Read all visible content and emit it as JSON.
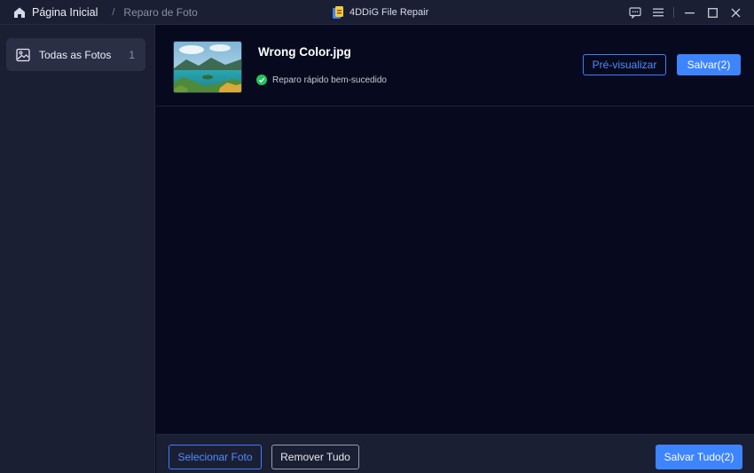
{
  "titlebar": {
    "home_label": "Página Inicial",
    "separator": "/",
    "current_page": "Reparo de Foto",
    "app_title": "4DDiG File Repair"
  },
  "sidebar": {
    "items": [
      {
        "label": "Todas as Fotos",
        "count": "1",
        "icon": "image-icon"
      }
    ]
  },
  "files": [
    {
      "name": "Wrong Color.jpg",
      "status": "Reparo rápido bem-sucedido",
      "preview_label": "Pré-visualizar",
      "save_label": "Salvar(2)"
    }
  ],
  "footer": {
    "select_label": "Selecionar Foto",
    "remove_label": "Remover Tudo",
    "save_all_label": "Salvar Tudo(2)"
  },
  "colors": {
    "accent": "#3d84ff",
    "success": "#22c55e",
    "background": "#070a1e",
    "panel": "#1b1f33"
  }
}
